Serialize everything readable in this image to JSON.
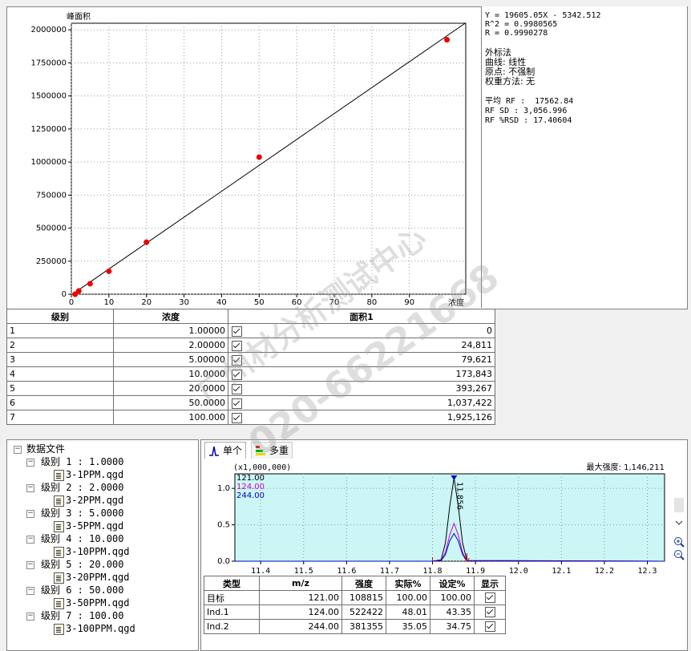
{
  "calibration": {
    "y_axis_label": "峰面积",
    "x_axis_label": "浓度",
    "y_ticks": [
      "2000000",
      "1750000",
      "1500000",
      "1250000",
      "1000000",
      "750000",
      "500000",
      "250000",
      "0"
    ],
    "x_ticks": [
      "0",
      "10",
      "20",
      "30",
      "40",
      "50",
      "60",
      "70",
      "80",
      "90"
    ]
  },
  "chart_data": [
    {
      "type": "scatter",
      "title": "",
      "xlabel": "浓度",
      "ylabel": "峰面积",
      "xlim": [
        0,
        105
      ],
      "ylim": [
        0,
        2050000
      ],
      "x": [
        1,
        2,
        5,
        10,
        20,
        50,
        100
      ],
      "y": [
        0,
        24811,
        79621,
        173843,
        393267,
        1037422,
        1925126
      ],
      "fit_line": {
        "slope": 19605.05,
        "intercept": -5342.512
      },
      "point_color": "#ee0000",
      "line_color": "#000000"
    },
    {
      "type": "line",
      "title": "",
      "xlabel": "",
      "ylabel": "",
      "xlim": [
        11.34,
        12.34
      ],
      "ylim": [
        0,
        1.2
      ],
      "y_scale_label": "(x1,000,000)",
      "series": [
        {
          "name": "121.00",
          "color": "#000000",
          "x": [
            11.8,
            11.82,
            11.83,
            11.84,
            11.85,
            11.86,
            11.87,
            11.88
          ],
          "y": [
            0,
            0.02,
            0.25,
            0.75,
            1.146,
            0.75,
            0.25,
            0.01
          ]
        },
        {
          "name": "124.00",
          "color": "#cc00cc",
          "x": [
            11.8,
            11.82,
            11.83,
            11.84,
            11.85,
            11.86,
            11.87,
            11.88
          ],
          "y": [
            0,
            0.01,
            0.12,
            0.36,
            0.52,
            0.36,
            0.12,
            0.005
          ]
        },
        {
          "name": "244.00",
          "color": "#0000cc",
          "x": [
            11.8,
            11.82,
            11.83,
            11.84,
            11.85,
            11.86,
            11.87,
            11.88
          ],
          "y": [
            0,
            0.01,
            0.09,
            0.28,
            0.38,
            0.28,
            0.09,
            0.004
          ]
        }
      ],
      "peak_label": "11.856"
    }
  ],
  "stats": {
    "equation": "Y = 19605.05X - 5342.512",
    "r2": "R^2 = 0.9980565",
    "r": "R = 0.9990278",
    "method": "外标法",
    "curve": "曲线: 线性",
    "origin": "原点: 不强制",
    "weight": "权重方法: 无",
    "avg_rf": "平均 RF :  17562.84",
    "rf_sd": "RF SD : 3,056.996",
    "rf_rsd": "RF %RSD : 17.40604"
  },
  "level_table": {
    "headers": [
      "级别",
      "浓度",
      "面积1"
    ],
    "rows": [
      {
        "level": "1",
        "conc": "1.00000",
        "area": "0"
      },
      {
        "level": "2",
        "conc": "2.00000",
        "area": "24,811"
      },
      {
        "level": "3",
        "conc": "5.00000",
        "area": "79,621"
      },
      {
        "level": "4",
        "conc": "10.0000",
        "area": "173,843"
      },
      {
        "level": "5",
        "conc": "20.0000",
        "area": "393,267"
      },
      {
        "level": "6",
        "conc": "50.0000",
        "area": "1,037,422"
      },
      {
        "level": "7",
        "conc": "100.000",
        "area": "1,925,126"
      }
    ]
  },
  "tree": {
    "root": "数据文件",
    "levels": [
      {
        "label": "级别 1 : 1.0000",
        "file": "3-1PPM.qgd"
      },
      {
        "label": "级别 2 : 2.0000",
        "file": "3-2PPM.qgd"
      },
      {
        "label": "级别 3 : 5.0000",
        "file": "3-5PPM.qgd"
      },
      {
        "label": "级别 4 : 10.000",
        "file": "3-10PPM.qgd"
      },
      {
        "label": "级别 5 : 20.000",
        "file": "3-20PPM.qgd"
      },
      {
        "label": "级别 6 : 50.000",
        "file": "3-50PPM.qgd"
      },
      {
        "label": "级别 7 : 100.00",
        "file": "3-100PPM.qgd"
      }
    ]
  },
  "chromatogram": {
    "tabs": [
      "单个",
      "多重"
    ],
    "scale_label": "(x1,000,000)",
    "max_intensity": "最大强度: 1,146,211",
    "y_ticks": [
      "1.0",
      "0.5",
      "0.0"
    ],
    "x_ticks": [
      "11.4",
      "11.5",
      "11.6",
      "11.7",
      "11.8",
      "11.9",
      "12.0",
      "12.1",
      "12.2",
      "12.3"
    ],
    "legend": [
      "121.00",
      "124.00",
      "244.00"
    ],
    "peak_label": "11.856"
  },
  "ion_table": {
    "headers": [
      "类型",
      "m/z",
      "强度",
      "实际%",
      "设定%",
      "显示"
    ],
    "rows": [
      {
        "type": "目标",
        "mz": "121.00",
        "intensity": "108815",
        "actual": "100.00",
        "set": "100.00"
      },
      {
        "type": "Ind.1",
        "mz": "124.00",
        "intensity": "522422",
        "actual": "48.01",
        "set": "43.35"
      },
      {
        "type": "Ind.2",
        "mz": "244.00",
        "intensity": "381355",
        "actual": "35.05",
        "set": "34.75"
      }
    ]
  },
  "watermark": {
    "line1": "广州材分析测试中心",
    "line2": "020-66221668"
  }
}
